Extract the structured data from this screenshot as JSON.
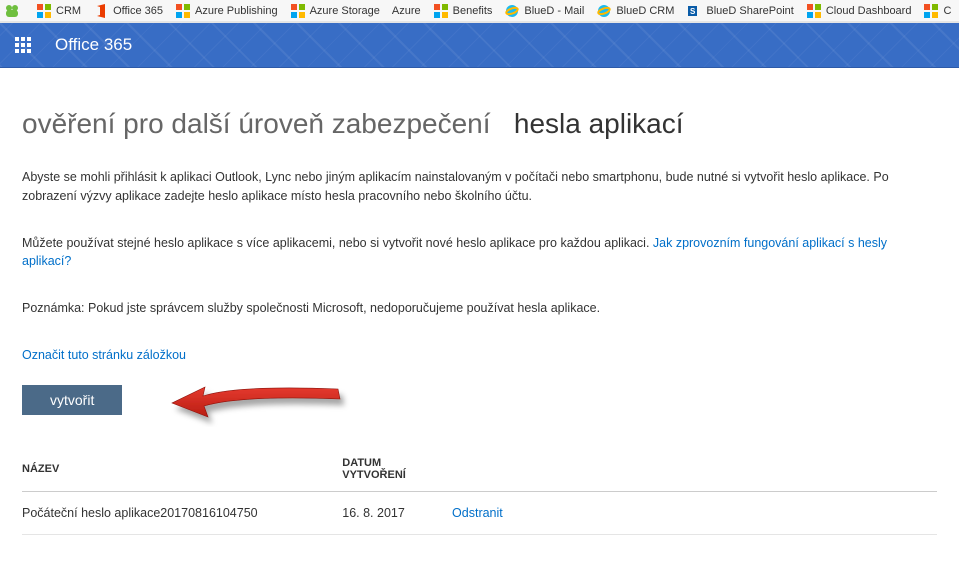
{
  "bookmarks": {
    "items": [
      {
        "label": "",
        "icon": "frog"
      },
      {
        "label": "CRM",
        "icon": "ms4"
      },
      {
        "label": "Office 365",
        "icon": "office"
      },
      {
        "label": "Azure Publishing",
        "icon": "ms4"
      },
      {
        "label": "Azure Storage",
        "icon": "ms4"
      },
      {
        "label": "Azure",
        "icon": "none"
      },
      {
        "label": "Benefits",
        "icon": "ms4"
      },
      {
        "label": "BlueD - Mail",
        "icon": "ie"
      },
      {
        "label": "BlueD CRM",
        "icon": "ie"
      },
      {
        "label": "BlueD SharePoint",
        "icon": "sp"
      },
      {
        "label": "Cloud Dashboard",
        "icon": "ms4"
      },
      {
        "label": "C",
        "icon": "ms4"
      }
    ]
  },
  "header": {
    "brand": "Office 365"
  },
  "page": {
    "title_light": "ověření pro další úroveň zabezpečení",
    "title_strong": "hesla aplikací",
    "paragraph1": "Abyste se mohli přihlásit k aplikaci Outlook, Lync nebo jiným aplikacím nainstalovaným v počítači nebo smartphonu, bude nutné si vytvořit heslo aplikace. Po zobrazení výzvy aplikace zadejte heslo aplikace místo hesla pracovního nebo školního účtu.",
    "paragraph2_prefix": "Můžete používat stejné heslo aplikace s více aplikacemi, nebo si vytvořit nové heslo aplikace pro každou aplikaci. ",
    "paragraph2_link": "Jak zprovozním fungování aplikací s hesly aplikací?",
    "paragraph3": "Poznámka: Pokud jste správcem služby společnosti Microsoft, nedoporučujeme používat hesla aplikace.",
    "bookmark_link": "Označit tuto stránku záložkou",
    "create_button": "vytvořit",
    "table": {
      "columns": {
        "name": "NÁZEV",
        "date": "DATUM VYTVOŘENÍ"
      },
      "rows": [
        {
          "name": "Počáteční heslo aplikace20170816104750",
          "date": "16. 8. 2017",
          "action": "Odstranit"
        }
      ]
    }
  }
}
